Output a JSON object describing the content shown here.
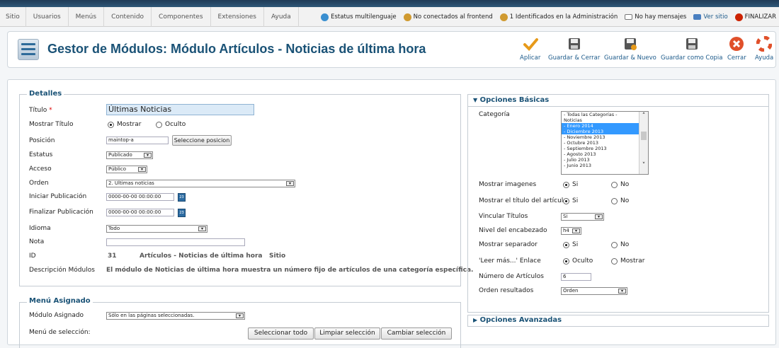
{
  "menu": [
    "Sitio",
    "Usuarios",
    "Menús",
    "Contenido",
    "Componentes",
    "Extensiones",
    "Ayuda"
  ],
  "status": {
    "multilang": "Estatus multilenguaje",
    "frontend": "No conectados al frontend",
    "admin": "1 Identificados en la Administración",
    "messages": "No hay mensajes",
    "view_site": "Ver sitio",
    "logout": "FINALIZAR"
  },
  "page_title": "Gestor de Módulos: Módulo Artículos - Noticias de última hora",
  "toolbar": {
    "apply": "Aplicar",
    "save_close": "Guardar & Cerrar",
    "save_new": "Guardar & Nuevo",
    "save_copy": "Guardar como Copia",
    "close": "Cerrar",
    "help": "Ayuda"
  },
  "details": {
    "legend": "Detalles",
    "title_label": "Título",
    "required_mark": "*",
    "title_value": "Últimas Noticias",
    "show_title_label": "Mostrar Título",
    "show": "Mostrar",
    "hidden": "Oculto",
    "position_label": "Posición",
    "position_value": "maintop-a",
    "select_position": "Seleccione posicion",
    "status_label": "Estatus",
    "status_value": "Publicado",
    "access_label": "Acceso",
    "access_value": "Público",
    "order_label": "Orden",
    "order_value": "2. Ultimas noticias",
    "start_label": "Iniciar Publicación",
    "start_value": "0000-00-00 00:00:00",
    "end_label": "Finalizar Publicación",
    "end_value": "0000-00-00 00:00:00",
    "calendar_day": "23",
    "language_label": "Idioma",
    "language_value": "Todo",
    "note_label": "Nota",
    "note_value": "",
    "id_label": "ID",
    "id_value": "31",
    "module_name": "Artículos - Noticias de última hora",
    "module_client": "Sitio",
    "desc_label": "Descripción Módulos",
    "desc_value": "El módulo de Noticias de última hora muestra un número fijo de artículos de una categoría específica."
  },
  "menu_assign": {
    "legend": "Menú Asignado",
    "module_label": "Módulo Asignado",
    "module_value": "Sólo en las páginas seleccionadas.",
    "selection_label": "Menú de selección:",
    "select_all": "Seleccionar todo",
    "clear": "Limpiar selección",
    "toggle": "Cambiar selección"
  },
  "basic": {
    "header": "Opciones Básicas",
    "category_label": "Categoría",
    "categories": [
      {
        "label": "- Todas las Categorías -",
        "selected": false
      },
      {
        "label": "Noticias",
        "selected": false
      },
      {
        "label": "- Enero 2014",
        "selected": true
      },
      {
        "label": "- Diciembre 2013",
        "selected": true
      },
      {
        "label": "- Noviembre 2013",
        "selected": false
      },
      {
        "label": "- Octubre 2013",
        "selected": false
      },
      {
        "label": "- Septiembre 2013",
        "selected": false
      },
      {
        "label": "- Agosto 2013",
        "selected": false
      },
      {
        "label": "- Julio 2013",
        "selected": false
      },
      {
        "label": "- Junio 2013",
        "selected": false
      }
    ],
    "show_images_label": "Mostrar imagenes",
    "show_art_title_label": "Mostrar el título del artículo",
    "yes": "Si",
    "no": "No",
    "link_titles_label": "Vincular Títulos",
    "link_titles_value": "Si",
    "heading_label": "Nivel del encabezado",
    "heading_value": "h4",
    "separator_label": "Mostrar separador",
    "readmore_label": "'Leer más...' Enlace",
    "readmore_hidden": "Oculto",
    "readmore_show": "Mostrar",
    "count_label": "Número de Artículos",
    "count_value": "6",
    "order_label": "Orden resultados",
    "order_value": "Orden"
  },
  "advanced": {
    "header": "Opciones Avanzadas"
  },
  "colors": {
    "accent": "#1a5276",
    "select_blue": "#3399ff",
    "logout_red": "#cc2200",
    "close_red": "#e0502a"
  }
}
